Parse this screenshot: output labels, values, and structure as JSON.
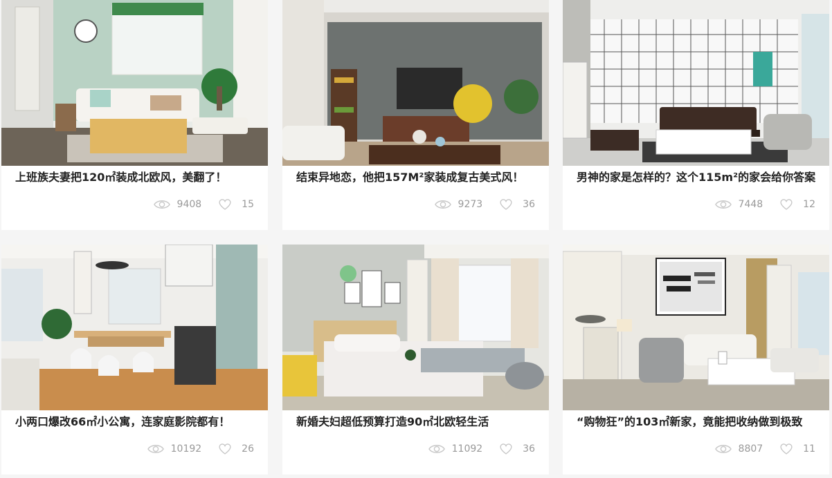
{
  "cards": [
    {
      "title": "上班族夫妻把120㎡装成北欧风，美翻了！",
      "views": "9408",
      "likes": "15",
      "image": "nordic-living-room-mint-wall"
    },
    {
      "title": "结束异地恋，他把157M²家装成复古美式风！",
      "views": "9273",
      "likes": "36",
      "image": "american-living-room-tv-wall"
    },
    {
      "title": "男神的家是怎样的？这个115m²的家会给你答案",
      "views": "7448",
      "likes": "12",
      "image": "grid-tile-living-room"
    },
    {
      "title": "小两口爆改66㎡小公寓，连家庭影院都有！",
      "views": "10192",
      "likes": "26",
      "image": "open-kitchen-dining"
    },
    {
      "title": "新婚夫妇超低预算打造90㎡北欧轻生活",
      "views": "11092",
      "likes": "36",
      "image": "nordic-bedroom"
    },
    {
      "title": "“购物狂”的103㎡新家，竟能把收纳做到极致",
      "views": "8807",
      "likes": "11",
      "image": "living-room-social-media-art"
    }
  ],
  "icons": {
    "views": "eye-icon",
    "likes": "heart-icon"
  },
  "colors": {
    "page_bg": "#f5f5f5",
    "card_bg": "#ffffff",
    "title": "#222222",
    "meta": "#999999"
  }
}
